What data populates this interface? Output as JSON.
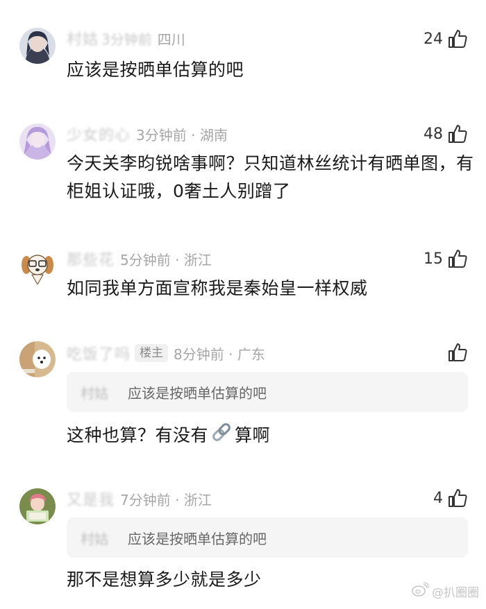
{
  "comments": [
    {
      "username": "村姑",
      "username_extra": "3分钟前",
      "time": "",
      "location": "四川",
      "likes": "24",
      "text": "应该是按晒单估算的吧"
    },
    {
      "username": "少女的心",
      "username_extra": "",
      "time": "3分钟前",
      "location": "湖南",
      "likes": "48",
      "text": "今天关李昀锐啥事啊？只知道林丝统计有晒单图，有柜姐认证哦，0奢土人别蹭了"
    },
    {
      "username": "那些花",
      "username_extra": "",
      "time": "5分钟前",
      "location": "浙江",
      "likes": "15",
      "text": "如同我单方面宣称我是秦始皇一样权威"
    },
    {
      "username": "吃饭了吗",
      "username_extra": "",
      "author_badge": "楼主",
      "time": "8分钟前",
      "location": "广东",
      "likes": "",
      "quote_name": "村姑",
      "quote_text": "应该是按晒单估算的吧",
      "text_before": "这种也算？有没有",
      "text_after": "算啊"
    },
    {
      "username": "又是我",
      "username_extra": "",
      "time": "7分钟前",
      "location": "浙江",
      "likes": "4",
      "quote_name": "村姑",
      "quote_text": "应该是按晒单估算的吧",
      "text": "那不是想算多少就是多少"
    }
  ],
  "watermark": "@扒圈圈",
  "icons": {
    "like": "thumbs-up-icon",
    "chain": "chain-link-icon",
    "watermark": "weibo-icon"
  },
  "colors": {
    "text": "#1a1a1a",
    "meta": "#a6a6a6",
    "quote_bg": "#f5f5f5"
  }
}
